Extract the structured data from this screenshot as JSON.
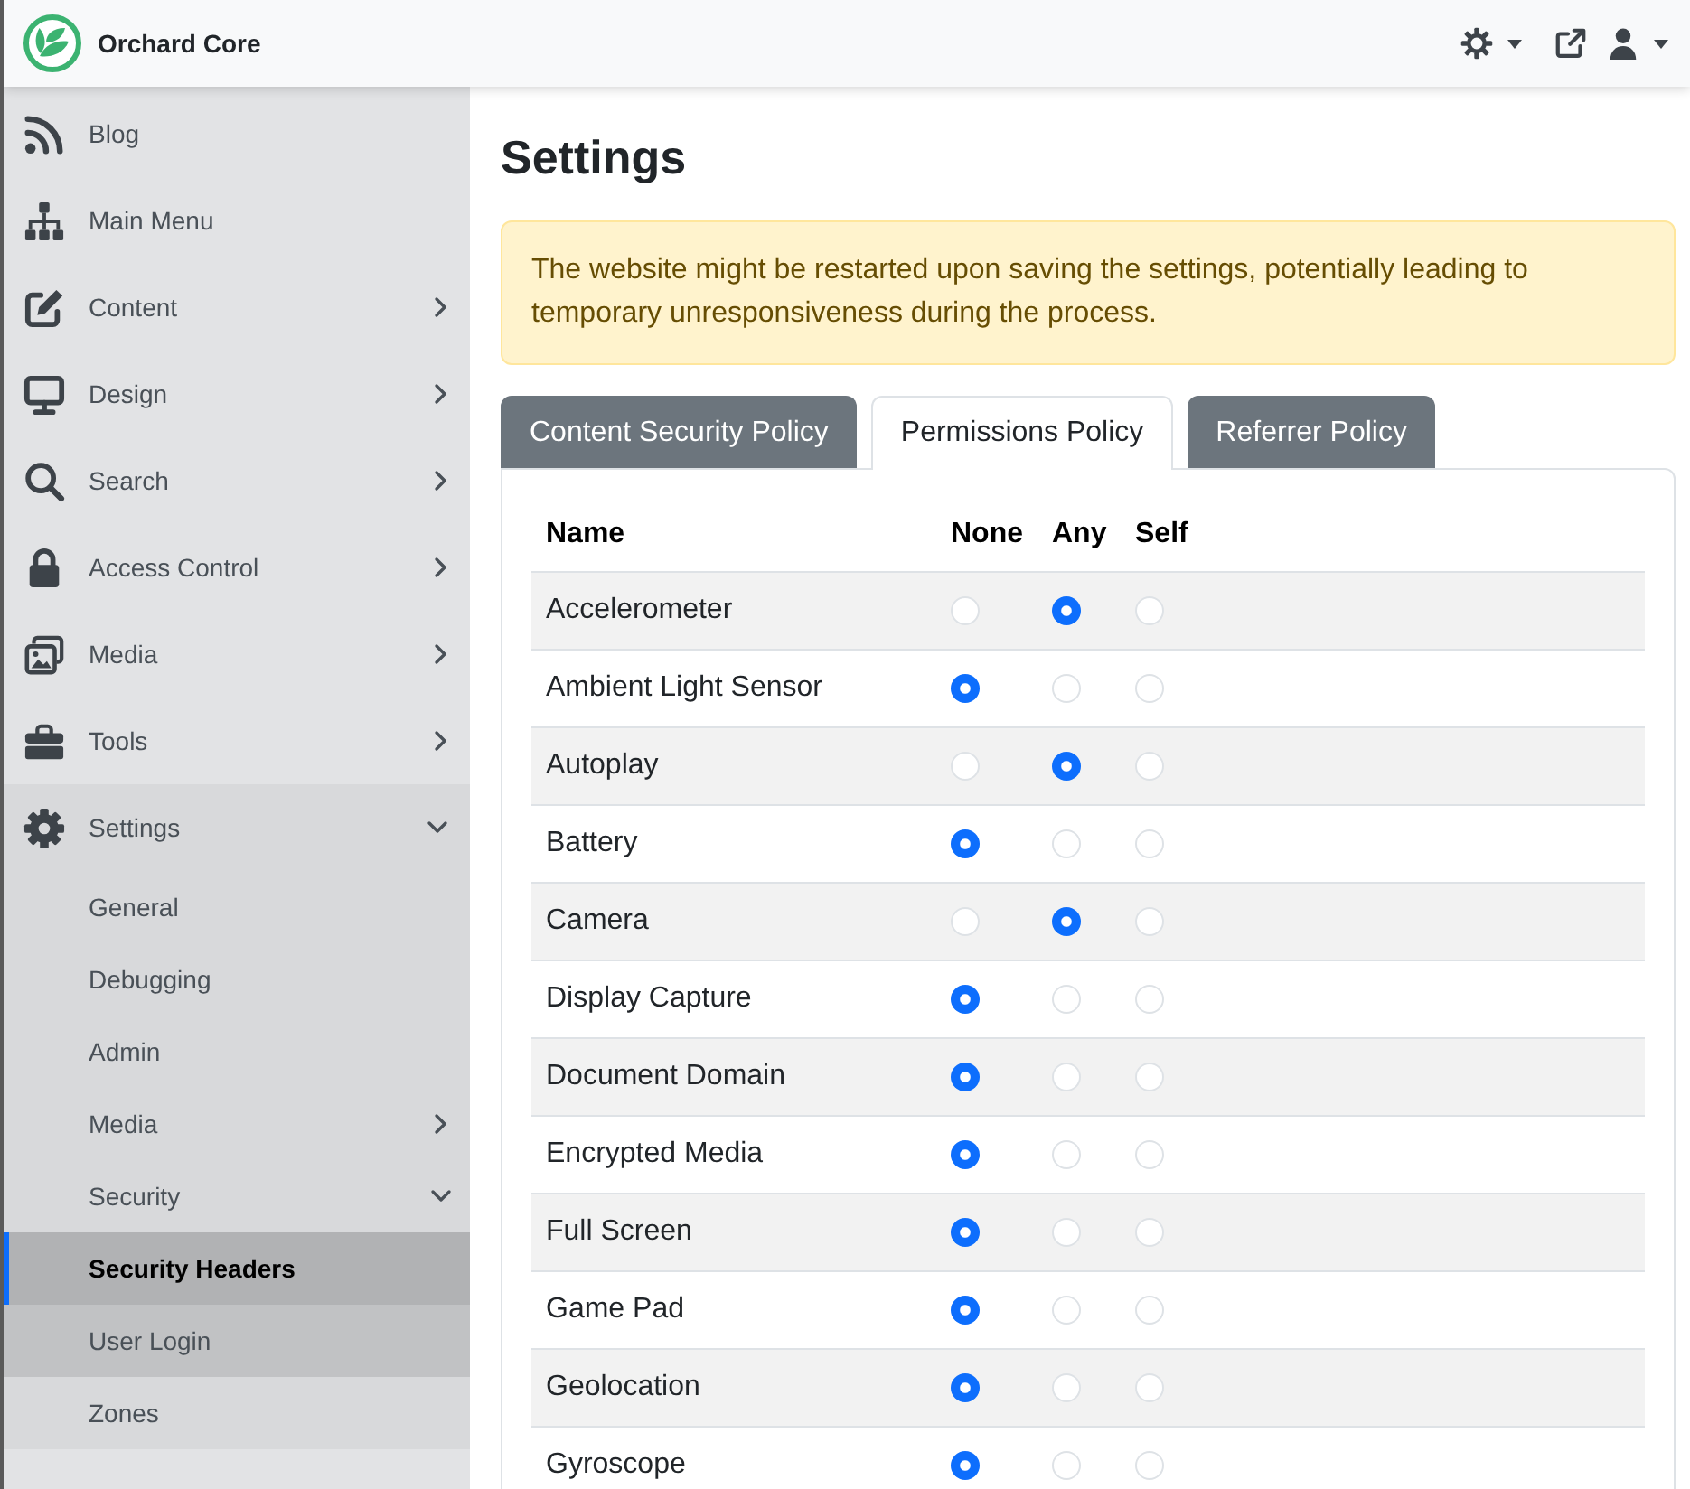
{
  "header": {
    "brand": "Orchard Core"
  },
  "sidebar": {
    "items": [
      {
        "label": "Blog",
        "kind": "link",
        "selected": false,
        "hovered": false
      },
      {
        "label": "Main Menu",
        "kind": "link",
        "selected": false,
        "hovered": false
      },
      {
        "label": "Content",
        "kind": "group",
        "expanded": false,
        "selected": false,
        "hovered": false
      },
      {
        "label": "Design",
        "kind": "group",
        "expanded": false,
        "selected": false,
        "hovered": false
      },
      {
        "label": "Search",
        "kind": "group",
        "expanded": false,
        "selected": false,
        "hovered": false
      },
      {
        "label": "Access Control",
        "kind": "group",
        "expanded": false,
        "selected": false,
        "hovered": false
      },
      {
        "label": "Media",
        "kind": "group",
        "expanded": false,
        "selected": false,
        "hovered": false
      },
      {
        "label": "Tools",
        "kind": "group",
        "expanded": false,
        "selected": false,
        "hovered": false
      },
      {
        "label": "Settings",
        "kind": "group",
        "expanded": true,
        "selected": false,
        "hovered": false,
        "children": [
          {
            "label": "General",
            "kind": "link",
            "selected": false,
            "hovered": false
          },
          {
            "label": "Debugging",
            "kind": "link",
            "selected": false,
            "hovered": false
          },
          {
            "label": "Admin",
            "kind": "link",
            "selected": false,
            "hovered": false
          },
          {
            "label": "Media",
            "kind": "group",
            "expanded": false,
            "selected": false,
            "hovered": false
          },
          {
            "label": "Security",
            "kind": "group",
            "expanded": true,
            "selected": false,
            "hovered": false,
            "children": [
              {
                "label": "Security Headers",
                "kind": "link",
                "selected": true,
                "hovered": false
              }
            ]
          },
          {
            "label": "User Login",
            "kind": "link",
            "selected": false,
            "hovered": true
          },
          {
            "label": "Zones",
            "kind": "link",
            "selected": false,
            "hovered": false
          }
        ]
      }
    ]
  },
  "page": {
    "title": "Settings"
  },
  "alert": {
    "text": "The website might be restarted upon saving the settings, potentially leading to temporary unresponsiveness during the process."
  },
  "tabs": [
    {
      "label": "Content Security Policy",
      "selected": false
    },
    {
      "label": "Permissions Policy",
      "selected": true
    },
    {
      "label": "Referrer Policy",
      "selected": false
    }
  ],
  "table": {
    "columns": [
      "Name",
      "None",
      "Any",
      "Self"
    ],
    "rows": [
      {
        "name": "Accelerometer",
        "options": [
          {
            "selected": false
          },
          {
            "selected": true
          },
          {
            "selected": false
          }
        ]
      },
      {
        "name": "Ambient Light Sensor",
        "options": [
          {
            "selected": true
          },
          {
            "selected": false
          },
          {
            "selected": false
          }
        ]
      },
      {
        "name": "Autoplay",
        "options": [
          {
            "selected": false
          },
          {
            "selected": true
          },
          {
            "selected": false
          }
        ]
      },
      {
        "name": "Battery",
        "options": [
          {
            "selected": true
          },
          {
            "selected": false
          },
          {
            "selected": false
          }
        ]
      },
      {
        "name": "Camera",
        "options": [
          {
            "selected": false
          },
          {
            "selected": true
          },
          {
            "selected": false
          }
        ]
      },
      {
        "name": "Display Capture",
        "options": [
          {
            "selected": true
          },
          {
            "selected": false
          },
          {
            "selected": false
          }
        ]
      },
      {
        "name": "Document Domain",
        "options": [
          {
            "selected": true
          },
          {
            "selected": false
          },
          {
            "selected": false
          }
        ]
      },
      {
        "name": "Encrypted Media",
        "options": [
          {
            "selected": true
          },
          {
            "selected": false
          },
          {
            "selected": false
          }
        ]
      },
      {
        "name": "Full Screen",
        "options": [
          {
            "selected": true
          },
          {
            "selected": false
          },
          {
            "selected": false
          }
        ]
      },
      {
        "name": "Game Pad",
        "options": [
          {
            "selected": true
          },
          {
            "selected": false
          },
          {
            "selected": false
          }
        ]
      },
      {
        "name": "Geolocation",
        "options": [
          {
            "selected": true
          },
          {
            "selected": false
          },
          {
            "selected": false
          }
        ]
      },
      {
        "name": "Gyroscope",
        "options": [
          {
            "selected": true
          },
          {
            "selected": false
          },
          {
            "selected": false
          }
        ]
      }
    ]
  }
}
